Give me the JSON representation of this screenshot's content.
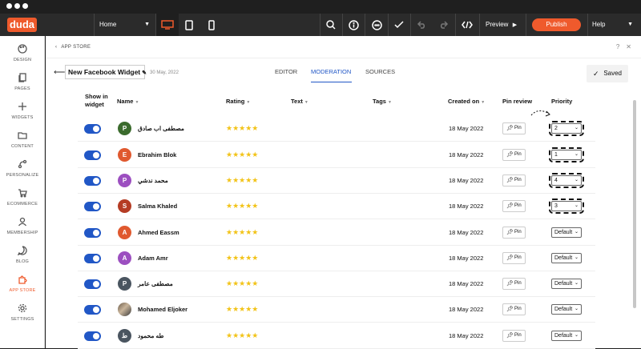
{
  "topnav": {
    "logo": "duda",
    "page": "Home",
    "preview": "Preview",
    "publish": "Publish",
    "help": "Help",
    "icons": [
      "desktop-icon",
      "tablet-icon",
      "mobile-icon",
      "search-icon",
      "info-icon",
      "comments-icon",
      "check-icon",
      "undo-icon",
      "redo-icon",
      "code-icon"
    ]
  },
  "sidebar": {
    "items": [
      {
        "label": "DESIGN",
        "icon": "palette-icon"
      },
      {
        "label": "PAGES",
        "icon": "pages-icon"
      },
      {
        "label": "WIDGETS",
        "icon": "plus-icon"
      },
      {
        "label": "CONTENT",
        "icon": "folder-icon"
      },
      {
        "label": "PERSONALIZE",
        "icon": "personalize-icon"
      },
      {
        "label": "ECOMMERCE",
        "icon": "cart-icon"
      },
      {
        "label": "MEMBERSHIP",
        "icon": "person-icon"
      },
      {
        "label": "BLOG",
        "icon": "chat-icon"
      },
      {
        "label": "APP STORE",
        "icon": "puzzle-icon"
      },
      {
        "label": "SETTINGS",
        "icon": "gear-icon"
      }
    ],
    "active": "APP STORE"
  },
  "panel": {
    "breadcrumb": "APP STORE",
    "widget_name": "New Facebook Widget",
    "date": "30 May, 2022",
    "tabs": [
      "EDITOR",
      "MODERATION",
      "SOURCES"
    ],
    "active_tab": "MODERATION",
    "saved": "Saved"
  },
  "table": {
    "headers": {
      "show": "Show in widget",
      "name": "Name",
      "rating": "Rating",
      "text": "Text",
      "tags": "Tags",
      "created": "Created on",
      "pin": "Pin review",
      "priority": "Priority"
    },
    "pin_label": "Pin",
    "rows": [
      {
        "name": "مصطفى اب صادق",
        "avatar": "P",
        "color": "#3b6b2d",
        "created": "18 May 2022",
        "priority": "2",
        "stars": "★★★★★"
      },
      {
        "name": "Ebrahim Blok",
        "avatar": "E",
        "color": "#e0592f",
        "created": "18 May 2022",
        "priority": "1",
        "stars": "★★★★★"
      },
      {
        "name": "محمد ندشي",
        "avatar": "P",
        "color": "#9c4fc0",
        "created": "18 May 2022",
        "priority": "4",
        "stars": "★★★★★"
      },
      {
        "name": "Salma Khaled",
        "avatar": "S",
        "color": "#b53c24",
        "created": "18 May 2022",
        "priority": "3",
        "stars": "★★★★★"
      },
      {
        "name": "Ahmed Eassm",
        "avatar": "A",
        "color": "#e0592f",
        "created": "18 May 2022",
        "priority": "Default",
        "stars": "★★★★★"
      },
      {
        "name": "Adam Amr",
        "avatar": "A",
        "color": "#9c4fc0",
        "created": "18 May 2022",
        "priority": "Default",
        "stars": "★★★★★"
      },
      {
        "name": "مصطفى عامر",
        "avatar": "P",
        "color": "#4a5560",
        "created": "18 May 2022",
        "priority": "Default",
        "stars": "★★★★★"
      },
      {
        "name": "Mohamed Eljoker",
        "avatar": "",
        "color": "#5a4a3a",
        "created": "18 May 2022",
        "priority": "Default",
        "stars": "★★★★★"
      },
      {
        "name": "طه محمود",
        "avatar": "ط",
        "color": "#4a5560",
        "created": "18 May 2022",
        "priority": "Default",
        "stars": "★★★★★"
      }
    ]
  }
}
